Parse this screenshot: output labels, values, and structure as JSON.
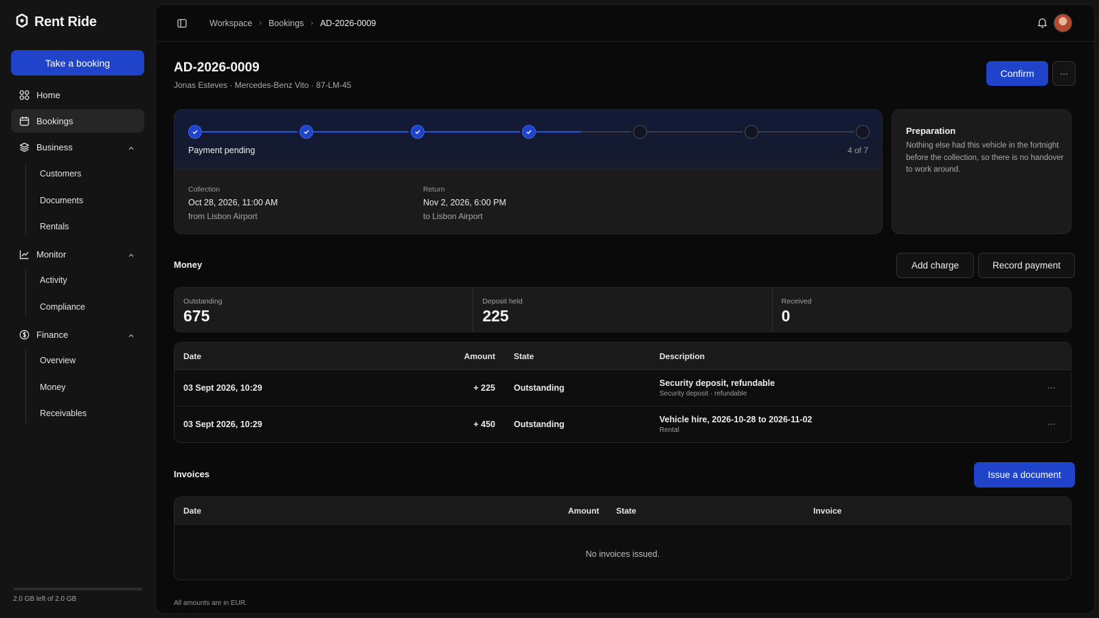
{
  "app": {
    "name": "Rent Ride"
  },
  "sidebar": {
    "cta_label": "Take a booking",
    "items": [
      {
        "label": "Home",
        "icon": "grid-icon"
      },
      {
        "label": "Bookings",
        "icon": "calendar-icon",
        "active": true
      },
      {
        "label": "Business",
        "icon": "layers-icon"
      },
      {
        "label": "Monitor",
        "icon": "chart-icon"
      },
      {
        "label": "Finance",
        "icon": "dollar-circle-icon"
      }
    ],
    "business_sub": [
      "Customers",
      "Documents",
      "Rentals"
    ],
    "monitor_sub": [
      "Activity",
      "Compliance"
    ],
    "finance_sub": [
      "Overview",
      "Money",
      "Receivables"
    ],
    "storage_text": "2.0 GB left of 2.0 GB"
  },
  "topbar": {
    "breadcrumbs": [
      "Workspace",
      "Bookings",
      "AD-2026-0009"
    ]
  },
  "booking": {
    "id": "AD-2026-0009",
    "subtitle": "Jonas Esteves · Mercedes-Benz Vito · 87-LM-45",
    "confirm_label": "Confirm",
    "more_label": "···"
  },
  "progress": {
    "steps_total": 7,
    "steps_done": 4,
    "current_label": "Payment pending",
    "count_label": "4 of 7"
  },
  "trip": {
    "collection_label": "Collection",
    "collection_date": "Oct 28, 2026, 11:00 AM",
    "collection_place": "from Lisbon Airport",
    "return_label": "Return",
    "return_date": "Nov 2, 2026, 6:00 PM",
    "return_place": "to Lisbon Airport"
  },
  "preparation": {
    "title": "Preparation",
    "text": "Nothing else had this vehicle in the fortnight before the collection, so there is no handover to work around."
  },
  "money": {
    "title": "Money",
    "add_charge_label": "Add charge",
    "record_payment_label": "Record payment",
    "stats": [
      {
        "label": "Outstanding",
        "value": "675"
      },
      {
        "label": "Deposit held",
        "value": "225"
      },
      {
        "label": "Received",
        "value": "0"
      }
    ],
    "columns": {
      "date": "Date",
      "amount": "Amount",
      "state": "State",
      "description": "Description"
    },
    "rows": [
      {
        "date": "03 Sept 2026, 10:29",
        "amount": "+ 225",
        "state": "Outstanding",
        "title": "Security deposit, refundable",
        "sub": "Security deposit · refundable",
        "more": "···"
      },
      {
        "date": "03 Sept 2026, 10:29",
        "amount": "+ 450",
        "state": "Outstanding",
        "title": "Vehicle hire, 2026-10-28 to 2026-11-02",
        "sub": "Rental",
        "more": "···"
      }
    ]
  },
  "invoices": {
    "title": "Invoices",
    "issue_label": "Issue a document",
    "columns": {
      "date": "Date",
      "amount": "Amount",
      "state": "State",
      "invoice": "Invoice"
    },
    "empty_text": "No invoices issued."
  },
  "footnote": "All amounts are in EUR.",
  "colors": {
    "accent": "#1f44c9",
    "background": "#0a0a0a",
    "sidebar": "#141414"
  }
}
